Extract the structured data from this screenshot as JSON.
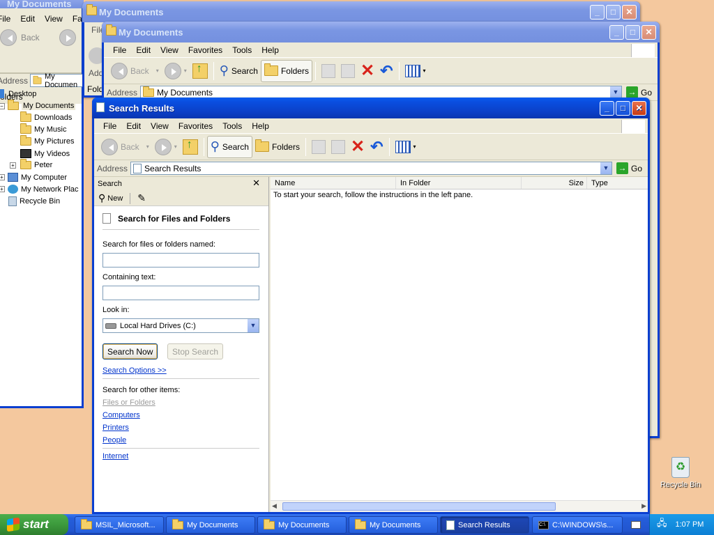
{
  "bg_window": {
    "title": "My Documents",
    "menu": [
      "File",
      "Edit",
      "View",
      "Fav"
    ],
    "back_label": "Back",
    "address_label": "Address",
    "address_value": "My Documen",
    "folders_label": "olders",
    "tree": [
      "Desktop",
      "My Documents",
      "Downloads",
      "My Music",
      "My Pictures",
      "My Videos",
      "Peter",
      "My Computer",
      "My Network Plac",
      "Recycle Bin"
    ]
  },
  "mid_window": {
    "title": "My Documents",
    "menu_partial": "File",
    "address_partial": "Add",
    "folders_partial": "Fold"
  },
  "front_back_window": {
    "title": "My Documents",
    "menu": [
      "File",
      "Edit",
      "View",
      "Favorites",
      "Tools",
      "Help"
    ],
    "back_label": "Back",
    "search_label": "Search",
    "folders_label": "Folders",
    "address_label": "Address",
    "address_value": "My Documents",
    "go_label": "Go"
  },
  "search_window": {
    "title": "Search Results",
    "menu": [
      "File",
      "Edit",
      "View",
      "Favorites",
      "Tools",
      "Help"
    ],
    "back_label": "Back",
    "search_label": "Search",
    "folders_label": "Folders",
    "address_label": "Address",
    "address_value": "Search Results",
    "go_label": "Go",
    "pane_title": "Search",
    "new_label": "New",
    "heading": "Search for Files and Folders",
    "named_label": "Search for files or folders named:",
    "named_value": "",
    "containing_label": "Containing text:",
    "containing_value": "",
    "lookin_label": "Look in:",
    "lookin_value": "Local Hard Drives (C:)",
    "search_now": "Search Now",
    "stop_search": "Stop Search",
    "search_options": "Search Options >>",
    "other_items": "Search for other items:",
    "links": [
      "Files or Folders",
      "Computers",
      "Printers",
      "People"
    ],
    "internet": "Internet",
    "columns": [
      "Name",
      "In Folder",
      "Size",
      "Type"
    ],
    "instructions": "To start your search, follow the instructions in the left pane."
  },
  "desktop": {
    "recycle_bin": "Recycle Bin"
  },
  "taskbar": {
    "start": "start",
    "items": [
      "MSIL_Microsoft...",
      "My Documents",
      "My Documents",
      "My Documents",
      "Search Results",
      "C:\\WINDOWS\\s..."
    ],
    "clock": "1:07 PM"
  },
  "colors": {
    "desktop": "#f4c89e",
    "title_active": "#0b3fc7",
    "taskbar": "#245edb",
    "start": "#3c9a3c"
  }
}
